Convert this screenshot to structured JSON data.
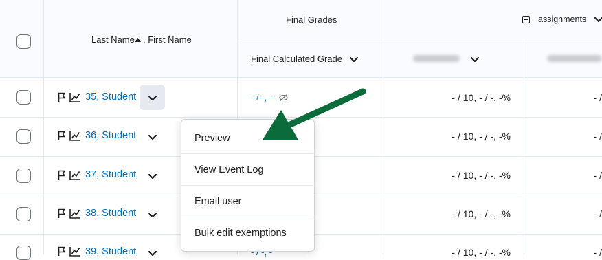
{
  "header": {
    "name_col_label_a": "Last Name",
    "name_col_label_b": ", First Name",
    "final_grades_label": "Final Grades",
    "final_calc_label": "Final Calculated Grade",
    "assignments_label": "assignments",
    "collapse_symbol": "−"
  },
  "rows": [
    {
      "name": "35, Student",
      "final_grade": "- / -, -",
      "score": "- / 10, - / -, -%",
      "score2": "- /"
    },
    {
      "name": "36, Student",
      "final_grade": "",
      "score": "- / 10, - / -, -%",
      "score2": "- /"
    },
    {
      "name": "37, Student",
      "final_grade": "",
      "score": "- / 10, - / -, -%",
      "score2": "- /"
    },
    {
      "name": "38, Student",
      "final_grade": "",
      "score": "- / 10, - / -, -%",
      "score2": "- /"
    },
    {
      "name": "39, Student",
      "final_grade": "- / -, -",
      "score": "- / 10, - / -, -%",
      "score2": "- /"
    }
  ],
  "menu": {
    "items": [
      "Preview",
      "View Event Log",
      "Email user",
      "Bulk edit exemptions"
    ]
  },
  "colors": {
    "link": "#006fbf",
    "arrow": "#0b6b3a",
    "header_bg": "#f9fbff"
  }
}
